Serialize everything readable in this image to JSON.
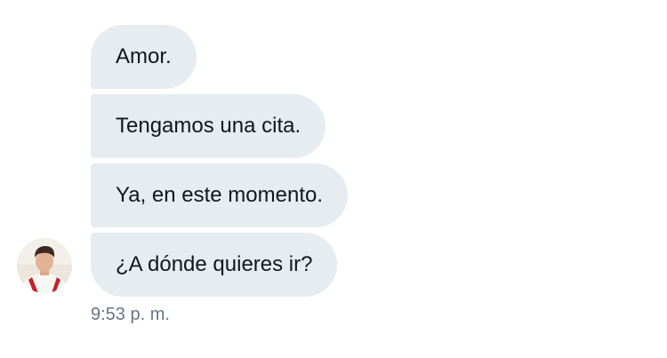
{
  "conversation": {
    "messages": [
      {
        "text": "Amor."
      },
      {
        "text": "Tengamos una cita."
      },
      {
        "text": "Ya, en este momento."
      },
      {
        "text": "¿A dónde quieres ir?"
      }
    ],
    "timestamp": "9:53 p. m."
  },
  "colors": {
    "bubble_background": "#e6ecf0",
    "message_text": "#14171a",
    "timestamp_text": "#657786"
  },
  "icons": {
    "avatar": "user-avatar-photo"
  }
}
